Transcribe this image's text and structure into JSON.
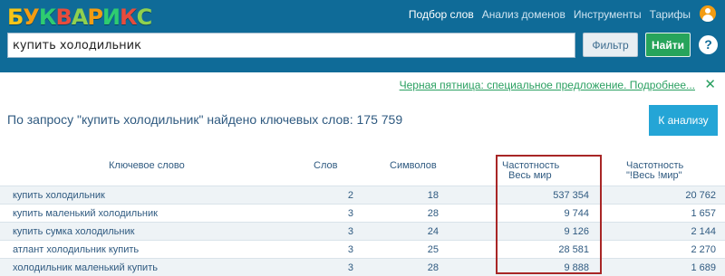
{
  "header": {
    "logo_letters": [
      "Б",
      "У",
      "К",
      "В",
      "А",
      "Р",
      "И",
      "К",
      "С"
    ],
    "logo_colors": [
      "#f5c518",
      "#f39c12",
      "#2ecc71",
      "#e74c3c",
      "#8fd14f",
      "#f39c12",
      "#2ecc71",
      "#e74c3c",
      "#8fd14f"
    ],
    "nav": [
      {
        "label": "Подбор слов",
        "active": true
      },
      {
        "label": "Анализ доменов",
        "active": false
      },
      {
        "label": "Инструменты",
        "active": false
      },
      {
        "label": "Тарифы",
        "active": false
      }
    ],
    "user_icon": "user-icon"
  },
  "search": {
    "value": "купить холодильник",
    "filter_label": "Фильтр",
    "find_label": "Найти",
    "help_label": "?"
  },
  "promo": {
    "text": "Черная пятница: специальное предложение. Подробнее...",
    "close": "✕"
  },
  "results": {
    "text": "По запросу \"купить холодильник\" найдено ключевых слов: 175 759",
    "analyze_label": "К анализу"
  },
  "table": {
    "headers": {
      "keyword": "Ключевое слово",
      "words": "Слов",
      "chars": "Символов",
      "freq_line1": "Частотность",
      "freq_line2": "Весь мир",
      "freqx_line1": "Частотность",
      "freqx_line2": "\"!Весь !мир\""
    },
    "rows": [
      {
        "keyword": "купить холодильник",
        "words": "2",
        "chars": "18",
        "freq": "537 354",
        "freqx": "20 762"
      },
      {
        "keyword": "купить маленький холодильник",
        "words": "3",
        "chars": "28",
        "freq": "9 744",
        "freqx": "1 657"
      },
      {
        "keyword": "купить сумка холодильник",
        "words": "3",
        "chars": "24",
        "freq": "9 126",
        "freqx": "2 144"
      },
      {
        "keyword": "атлант холодильник купить",
        "words": "3",
        "chars": "25",
        "freq": "28 581",
        "freqx": "2 270"
      },
      {
        "keyword": "холодильник маленький купить",
        "words": "3",
        "chars": "28",
        "freq": "9 888",
        "freqx": "1 689"
      }
    ]
  },
  "colors": {
    "header_bg": "#0f6b98",
    "find_button": "#27a45b",
    "analyze_button": "#24a5d6",
    "promo_link": "#2aa061",
    "highlight_box": "#a82626"
  }
}
